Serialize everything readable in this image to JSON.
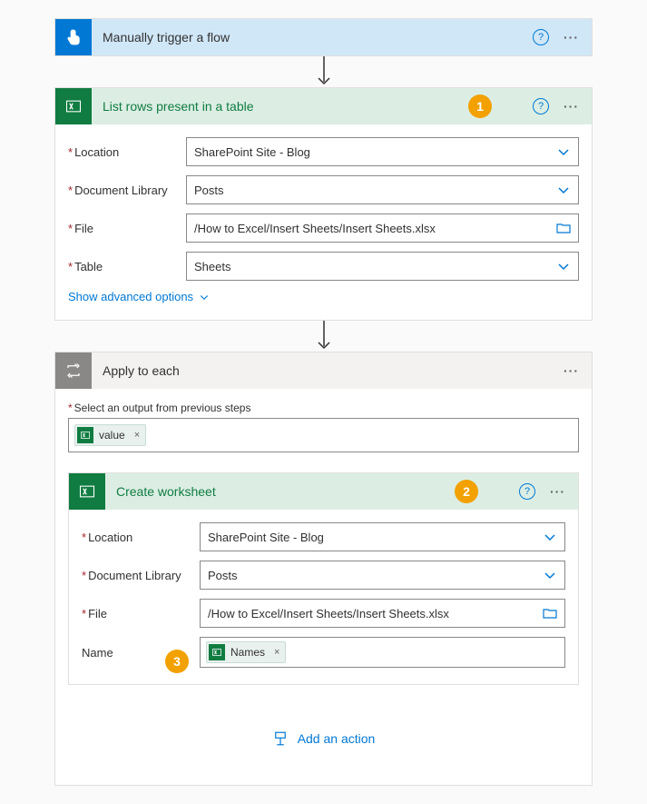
{
  "trigger": {
    "title": "Manually trigger a flow"
  },
  "listRows": {
    "title": "List rows present in a table",
    "badge": "1",
    "fields": {
      "location_label": "Location",
      "location_value": "SharePoint Site - Blog",
      "library_label": "Document Library",
      "library_value": "Posts",
      "file_label": "File",
      "file_value": "/How to Excel/Insert Sheets/Insert Sheets.xlsx",
      "table_label": "Table",
      "table_value": "Sheets"
    },
    "advanced_label": "Show advanced options"
  },
  "applyEach": {
    "title": "Apply to each",
    "select_label": "Select an output from previous steps",
    "token_value": "value"
  },
  "createWs": {
    "title": "Create worksheet",
    "badge": "2",
    "fields": {
      "location_label": "Location",
      "location_value": "SharePoint Site - Blog",
      "library_label": "Document Library",
      "library_value": "Posts",
      "file_label": "File",
      "file_value": "/How to Excel/Insert Sheets/Insert Sheets.xlsx",
      "name_label": "Name",
      "name_badge": "3",
      "name_token": "Names"
    }
  },
  "add_action_label": "Add an action"
}
